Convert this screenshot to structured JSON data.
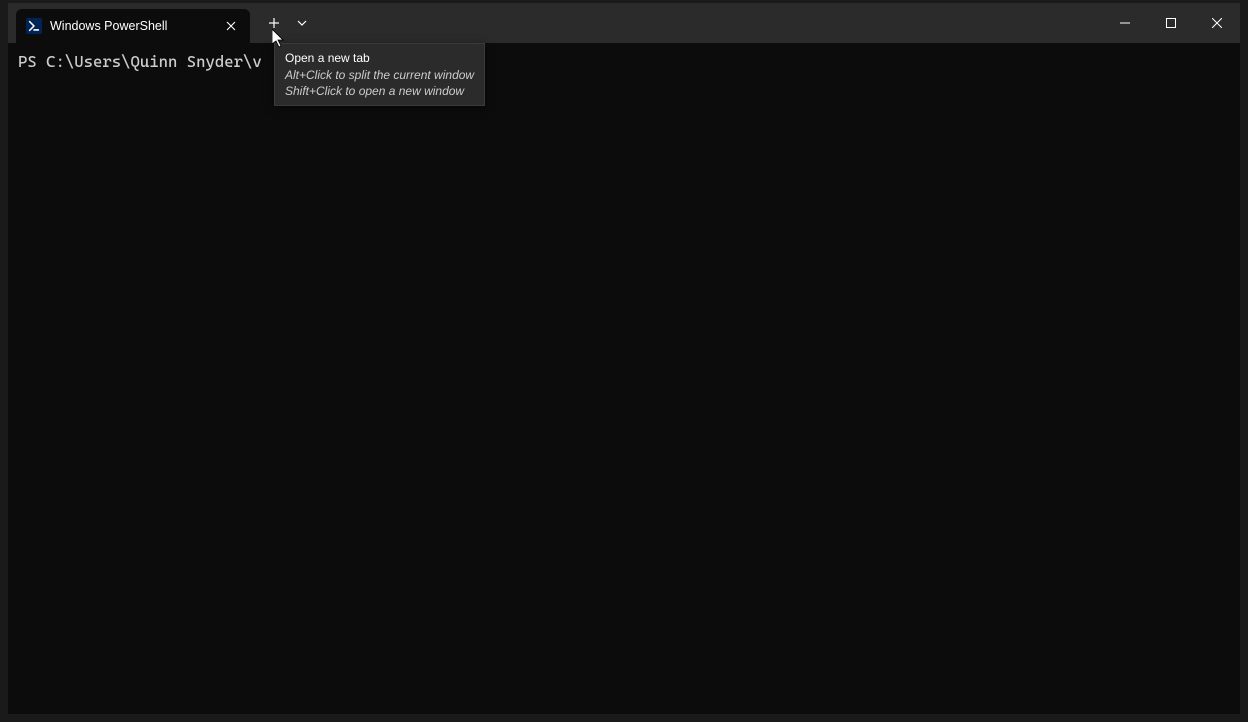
{
  "tab": {
    "title": "Windows PowerShell"
  },
  "terminal": {
    "prompt_line": "PS C:\\Users\\Quinn Snyder\\v"
  },
  "tooltip": {
    "title": "Open a new tab",
    "line1": "Alt+Click to split the current window",
    "line2": "Shift+Click to open a new window"
  }
}
